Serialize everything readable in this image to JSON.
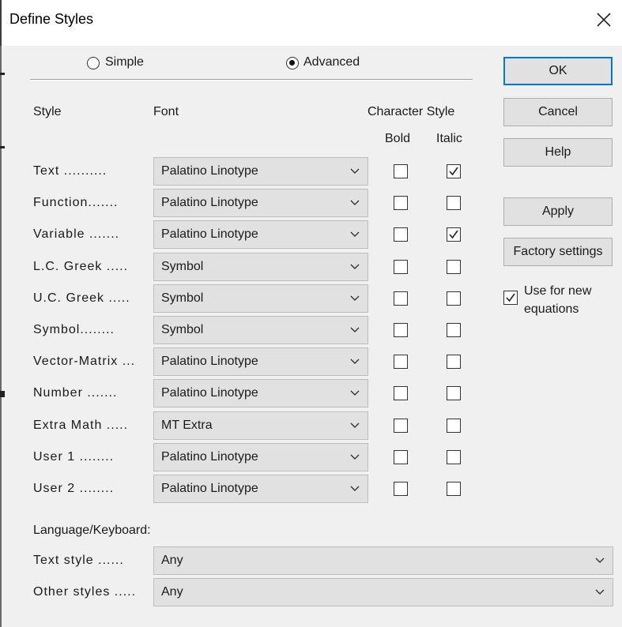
{
  "window": {
    "title": "Define Styles"
  },
  "mode": {
    "options": [
      {
        "label": "Simple",
        "selected": false
      },
      {
        "label": "Advanced",
        "selected": true
      }
    ]
  },
  "headers": {
    "style": "Style",
    "font": "Font",
    "character_style": "Character Style",
    "bold": "Bold",
    "italic": "Italic"
  },
  "styles": [
    {
      "label": "Text ..........",
      "font": "Palatino Linotype",
      "bold": false,
      "italic": true
    },
    {
      "label": "Function.......",
      "font": "Palatino Linotype",
      "bold": false,
      "italic": false
    },
    {
      "label": "Variable .......",
      "font": "Palatino Linotype",
      "bold": false,
      "italic": true
    },
    {
      "label": "L.C. Greek .....",
      "font": "Symbol",
      "bold": false,
      "italic": false
    },
    {
      "label": "U.C. Greek .....",
      "font": "Symbol",
      "bold": false,
      "italic": false
    },
    {
      "label": "Symbol........",
      "font": "Symbol",
      "bold": false,
      "italic": false
    },
    {
      "label": "Vector-Matrix ...",
      "font": "Palatino Linotype",
      "bold": false,
      "italic": false
    },
    {
      "label": "Number .......",
      "font": "Palatino Linotype",
      "bold": false,
      "italic": false
    },
    {
      "label": "Extra Math .....",
      "font": "MT Extra",
      "bold": false,
      "italic": false
    },
    {
      "label": "User 1 ........",
      "font": "Palatino Linotype",
      "bold": false,
      "italic": false
    },
    {
      "label": "User 2 ........",
      "font": "Palatino Linotype",
      "bold": false,
      "italic": false
    }
  ],
  "language": {
    "heading": "Language/Keyboard:",
    "text_style_label": "Text style ......",
    "text_style_value": "Any",
    "other_styles_label": "Other styles .....",
    "other_styles_value": "Any"
  },
  "buttons": {
    "ok": "OK",
    "cancel": "Cancel",
    "help": "Help",
    "apply": "Apply",
    "factory": "Factory settings"
  },
  "use_for_new": {
    "label_line1": "Use for new",
    "label_line2": "equations",
    "checked": true
  },
  "icons": {
    "close": "close-icon",
    "dropdown": "chevron-down-icon",
    "check": "check-icon"
  },
  "colors": {
    "default_button_border": "#0078d7",
    "dialog_bg": "#f0f0f0"
  }
}
